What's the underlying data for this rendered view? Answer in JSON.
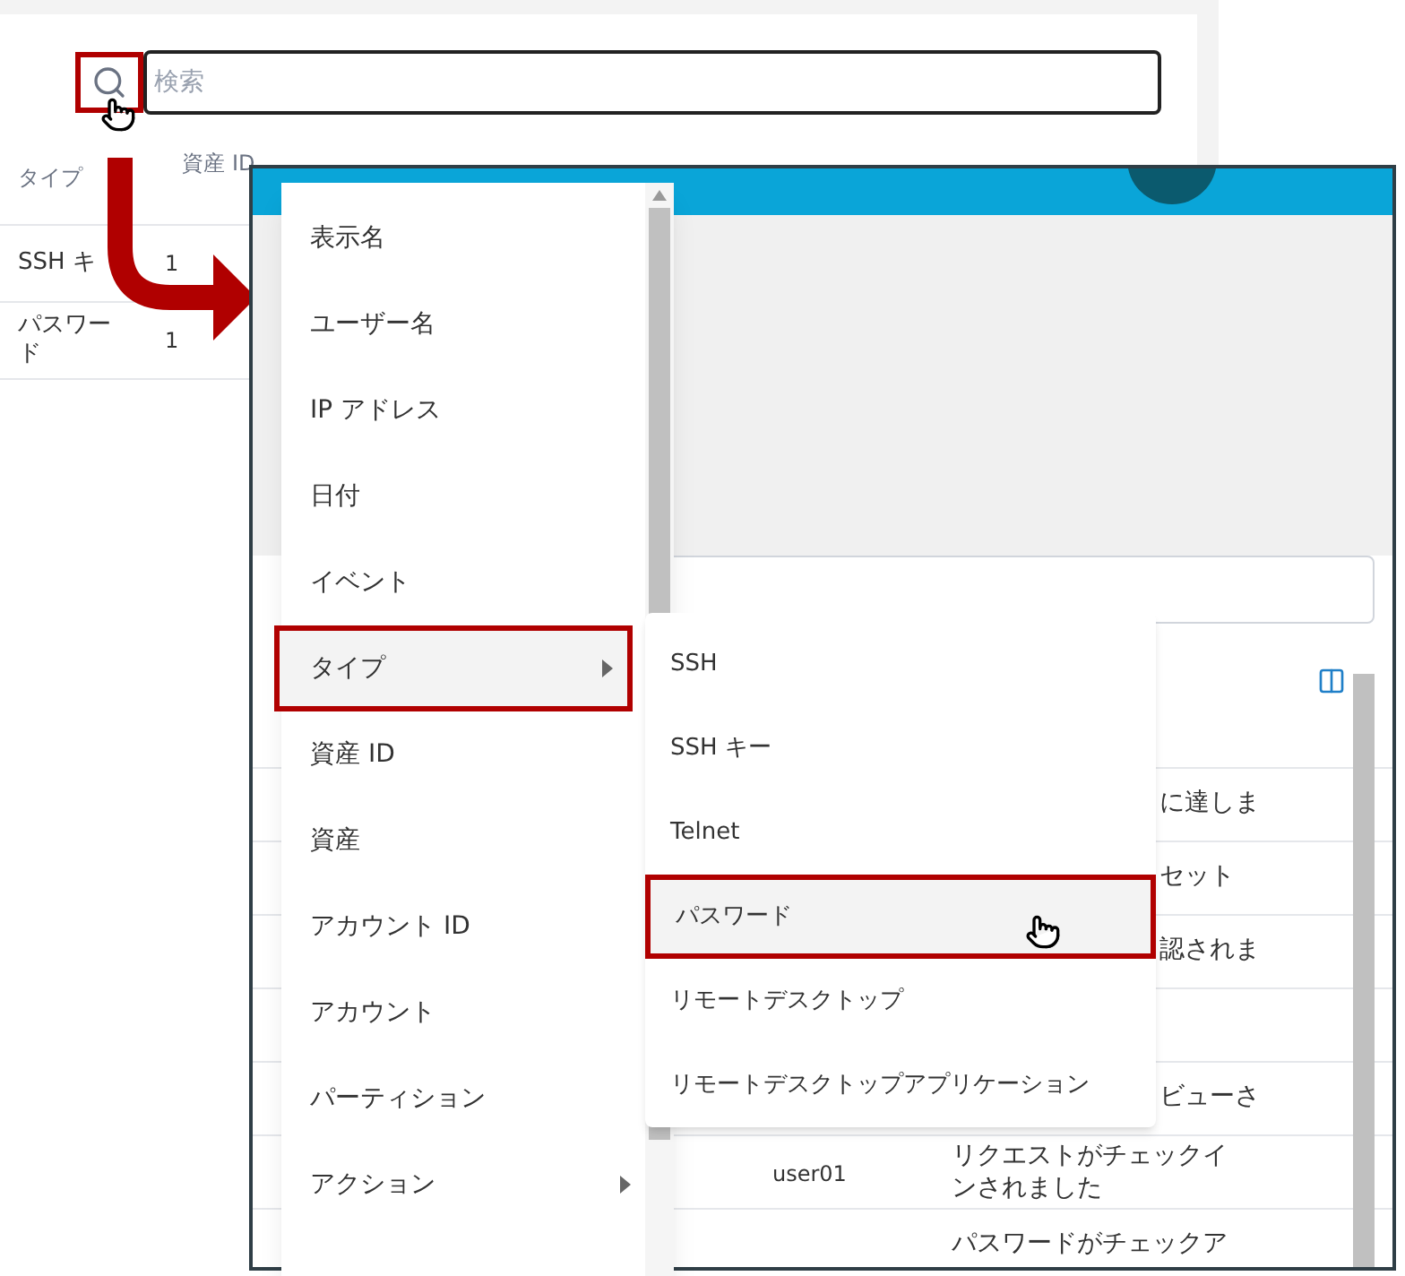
{
  "background": {
    "search": {
      "placeholder": "検索"
    },
    "table": {
      "columns": [
        "タイプ",
        "資産 ID"
      ],
      "rows": [
        [
          "SSH キ",
          "1"
        ],
        [
          "パスワード",
          "1"
        ]
      ]
    }
  },
  "inner_table": {
    "rows": [
      {
        "message": "に達しま"
      },
      {
        "message": "セット"
      },
      {
        "message": "認されま"
      },
      {},
      {
        "message": "ビューさ"
      },
      {
        "user": "user01",
        "message": "リクエストがチェックインされました"
      },
      {
        "message": "パスワードがチェックア"
      }
    ]
  },
  "menu": {
    "items": [
      {
        "label": "表示名",
        "submenu": false,
        "highlighted": false
      },
      {
        "label": "ユーザー名",
        "submenu": false,
        "highlighted": false
      },
      {
        "label": "IP アドレス",
        "submenu": false,
        "highlighted": false
      },
      {
        "label": "日付",
        "submenu": false,
        "highlighted": false
      },
      {
        "label": "イベント",
        "submenu": false,
        "highlighted": false
      },
      {
        "label": "タイプ",
        "submenu": true,
        "highlighted": true
      },
      {
        "label": "資産 ID",
        "submenu": false,
        "highlighted": false
      },
      {
        "label": "資産",
        "submenu": false,
        "highlighted": false
      },
      {
        "label": "アカウント ID",
        "submenu": false,
        "highlighted": false
      },
      {
        "label": "アカウント",
        "submenu": false,
        "highlighted": false
      },
      {
        "label": "パーティション",
        "submenu": false,
        "highlighted": false
      },
      {
        "label": "アクション",
        "submenu": true,
        "highlighted": false
      }
    ]
  },
  "submenu": {
    "items": [
      {
        "label": "SSH",
        "selected": false
      },
      {
        "label": "SSH キー",
        "selected": false
      },
      {
        "label": "Telnet",
        "selected": false
      },
      {
        "label": "パスワード",
        "selected": true
      },
      {
        "label": "リモートデスクトップ",
        "selected": false
      },
      {
        "label": "リモートデスクトップアプリケーション",
        "selected": false
      }
    ]
  }
}
